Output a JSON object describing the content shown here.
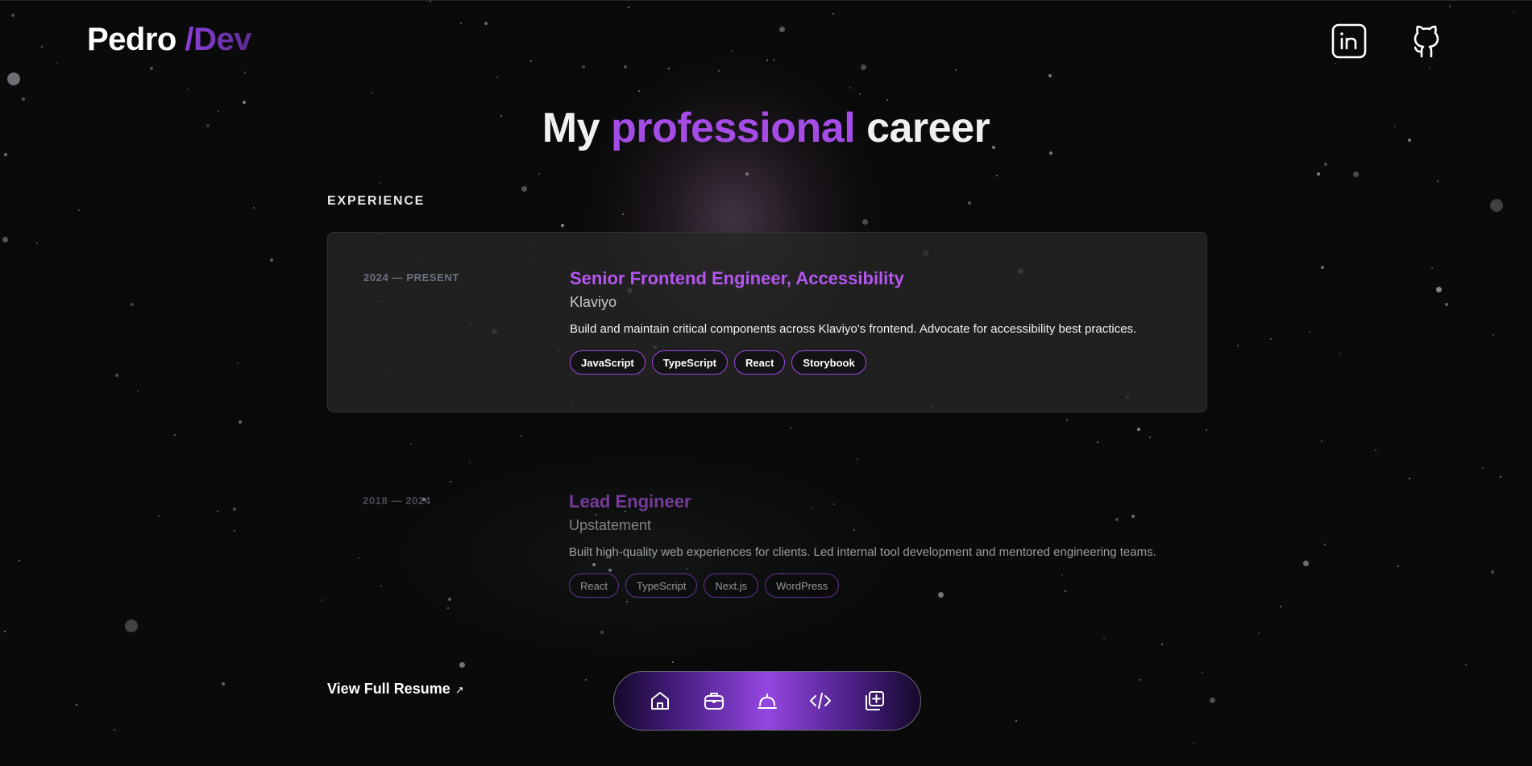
{
  "header": {
    "logo_name": "Pedro",
    "logo_accent": "/Dev",
    "social": [
      {
        "icon": "linkedin-icon"
      },
      {
        "icon": "github-icon"
      }
    ]
  },
  "hero": {
    "title_pre": "My",
    "title_highlight": "professional",
    "title_post": "career"
  },
  "experience": {
    "label": "EXPERIENCE",
    "items": [
      {
        "period": "2024 — PRESENT",
        "role": "Senior Frontend Engineer, Accessibility",
        "company": "Klaviyo",
        "description": "Build and maintain critical components across Klaviyo's frontend. Advocate for accessibility best practices.",
        "tags": [
          "JavaScript",
          "TypeScript",
          "React",
          "Storybook"
        ]
      },
      {
        "period": "2018 — 2024",
        "role": "Lead Engineer",
        "company": "Upstatement",
        "description": "Built high-quality web experiences for clients. Led internal tool development and mentored engineering teams.",
        "tags": [
          "React",
          "TypeScript",
          "Next.js",
          "WordPress"
        ]
      }
    ]
  },
  "footer": {
    "resume_label": "View Full Resume",
    "resume_arrow": "↗"
  },
  "dock": {
    "items": [
      {
        "icon": "home-icon"
      },
      {
        "icon": "briefcase-icon"
      },
      {
        "icon": "service-bell-icon"
      },
      {
        "icon": "code-icon"
      },
      {
        "icon": "add-stack-icon"
      }
    ]
  },
  "colors": {
    "background": "#0a0a0b",
    "accent": "#a54ce6",
    "card": "#262628",
    "muted": "#6b7280"
  }
}
